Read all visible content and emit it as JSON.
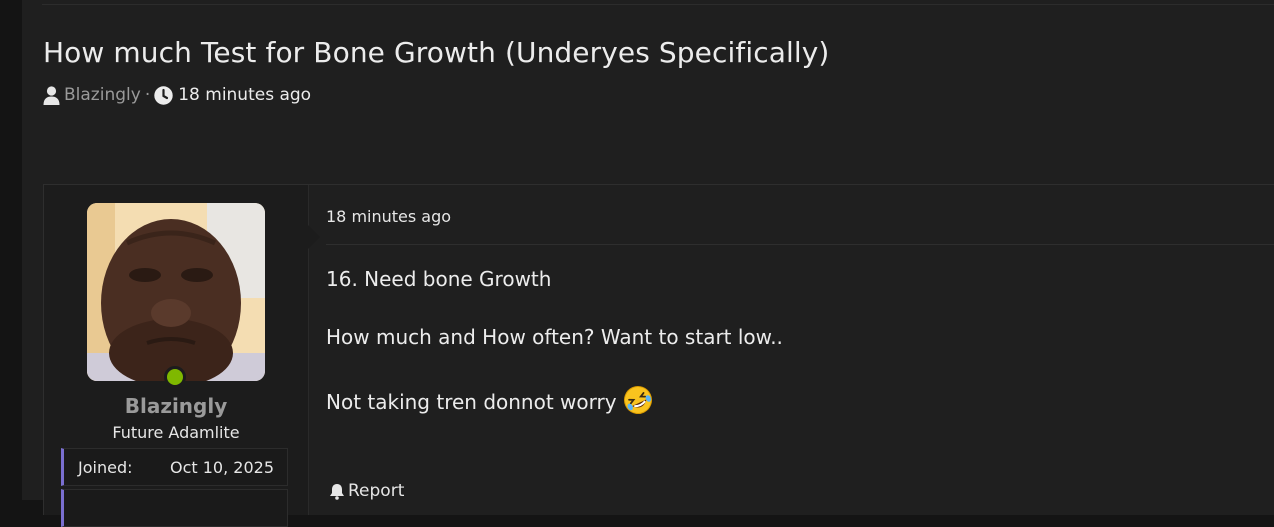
{
  "thread": {
    "title": "How much Test for Bone Growth (Underyes Specifically)",
    "author": "Blazingly",
    "separator": "·",
    "time": "18 minutes ago"
  },
  "post": {
    "user": {
      "name": "Blazingly",
      "title": "Future Adamlite",
      "status": "online",
      "stats": [
        {
          "label": "Joined:",
          "value": "Oct 10, 2025"
        }
      ]
    },
    "time": "18 minutes ago",
    "body": [
      "16. Need bone Growth",
      "How much and How often? Want to start low..",
      "Not taking tren donnot worry"
    ],
    "emoji": "rolling-on-floor-laughing-icon",
    "report_label": "Report"
  },
  "colors": {
    "background": "#1f1f1f",
    "online_indicator": "#7fb800",
    "stat_accent": "#7a6fd0",
    "muted_text": "#9a9a9a"
  }
}
